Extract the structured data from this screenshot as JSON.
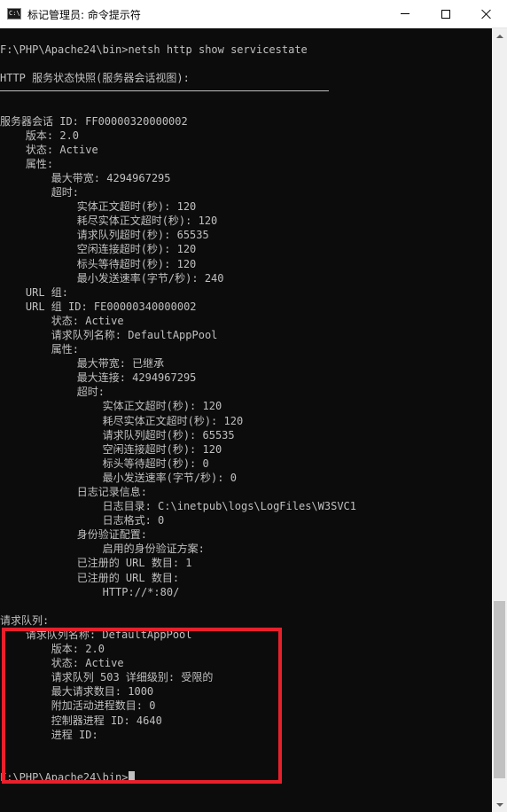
{
  "window": {
    "title": "标记管理员: 命令提示符",
    "icon_label": "C:\\",
    "controls": [
      "minimize",
      "maximize",
      "close"
    ]
  },
  "console": {
    "lines": [
      "",
      "F:\\PHP\\Apache24\\bin>netsh http show servicestate",
      "",
      "HTTP 服务状态快照(服务器会话视图):",
      "",
      "",
      "服务器会话 ID: FF00000320000002",
      "    版本: 2.0",
      "    状态: Active",
      "    属性:",
      "        最大带宽: 4294967295",
      "        超时:",
      "            实体正文超时(秒): 120",
      "            耗尽实体正文超时(秒): 120",
      "            请求队列超时(秒): 65535",
      "            空闲连接超时(秒): 120",
      "            标头等待超时(秒): 120",
      "            最小发送速率(字节/秒): 240",
      "    URL 组:",
      "    URL 组 ID: FE00000340000002",
      "        状态: Active",
      "        请求队列名称: DefaultAppPool",
      "        属性:",
      "            最大带宽: 已继承",
      "            最大连接: 4294967295",
      "            超时:",
      "                实体正文超时(秒): 120",
      "                耗尽实体正文超时(秒): 120",
      "                请求队列超时(秒): 65535",
      "                空闲连接超时(秒): 120",
      "                标头等待超时(秒): 0",
      "                最小发送速率(字节/秒): 0",
      "            日志记录信息:",
      "                日志目录: C:\\inetpub\\logs\\LogFiles\\W3SVC1",
      "                日志格式: 0",
      "            身份验证配置:",
      "                启用的身份验证方案:",
      "            已注册的 URL 数目: 1",
      "            已注册的 URL 数目:",
      "                HTTP://*:80/",
      "",
      "请求队列:",
      "    请求队列名称: DefaultAppPool",
      "        版本: 2.0",
      "        状态: Active",
      "        请求队列 503 详细级别: 受限的",
      "        最大请求数目: 1000",
      "        附加活动进程数目: 0",
      "        控制器进程 ID: 4640",
      "        进程 ID:",
      "",
      "",
      "F:\\PHP\\Apache24\\bin>"
    ]
  },
  "colors": {
    "console_bg": "#0c0c0c",
    "console_fg": "#c0c0c0",
    "highlight_border": "#e8202c",
    "titlebar_bg": "#ffffff"
  }
}
